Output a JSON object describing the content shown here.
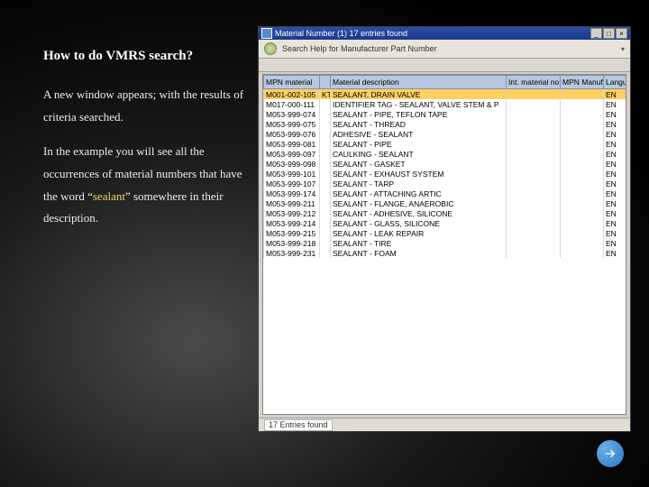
{
  "heading": "How to do VMRS search?",
  "para1_a": "A new window appears; with the results of criteria searched.",
  "para2_a": "In the example you will see all the occurrences of material numbers that have the word “",
  "para2_hl": "sealant",
  "para2_b": "” somewhere in their description.",
  "win": {
    "title": "Material Number (1)   17  entries found",
    "subtitle": "Search Help for Manufacturer Part Number",
    "status": "17 Entries found"
  },
  "cols": [
    "MPN material",
    "",
    "Material description",
    "Int. material no.",
    "MPN Manufact.",
    "Language"
  ],
  "rows": [
    {
      "c1": "M001-002-105",
      "c2": "KT",
      "c3": "SEALANT, DRAIN VALVE",
      "c6": "EN",
      "sel": true
    },
    {
      "c1": "M017-000-111",
      "c2": "",
      "c3": "IDENTIFIER TAG - SEALANT, VALVE STEM & P",
      "c6": "EN"
    },
    {
      "c1": "M053-999-074",
      "c2": "",
      "c3": "SEALANT - PIPE, TEFLON TAPE",
      "c6": "EN"
    },
    {
      "c1": "M053-999-075",
      "c2": "",
      "c3": "SEALANT - THREAD",
      "c6": "EN"
    },
    {
      "c1": "M053-999-076",
      "c2": "",
      "c3": "ADHESIVE - SEALANT",
      "c6": "EN"
    },
    {
      "c1": "M053-999-081",
      "c2": "",
      "c3": "SEALANT - PIPE",
      "c6": "EN"
    },
    {
      "c1": "M053-999-097",
      "c2": "",
      "c3": "CAULKING - SEALANT",
      "c6": "EN"
    },
    {
      "c1": "M053-999-098",
      "c2": "",
      "c3": "SEALANT - GASKET",
      "c6": "EN"
    },
    {
      "c1": "M053-999-101",
      "c2": "",
      "c3": "SEALANT - EXHAUST SYSTEM",
      "c6": "EN"
    },
    {
      "c1": "M053-999-107",
      "c2": "",
      "c3": "SEALANT - TARP",
      "c6": "EN"
    },
    {
      "c1": "M053-999-174",
      "c2": "",
      "c3": "SEALANT - ATTACHING ARTIC",
      "c6": "EN"
    },
    {
      "c1": "M053-999-211",
      "c2": "",
      "c3": "SEALANT - FLANGE, ANAEROBIC",
      "c6": "EN"
    },
    {
      "c1": "M053-999-212",
      "c2": "",
      "c3": "SEALANT - ADHESIVE, SILICONE",
      "c6": "EN"
    },
    {
      "c1": "M053-999-214",
      "c2": "",
      "c3": "SEALANT - GLASS, SILICONE",
      "c6": "EN"
    },
    {
      "c1": "M053-999-215",
      "c2": "",
      "c3": "SEALANT - LEAK REPAIR",
      "c6": "EN"
    },
    {
      "c1": "M053-999-218",
      "c2": "",
      "c3": "SEALANT - TIRE",
      "c6": "EN"
    },
    {
      "c1": "M053-999-231",
      "c2": "",
      "c3": "SEALANT - FOAM",
      "c6": "EN"
    }
  ],
  "next_label": "Next"
}
